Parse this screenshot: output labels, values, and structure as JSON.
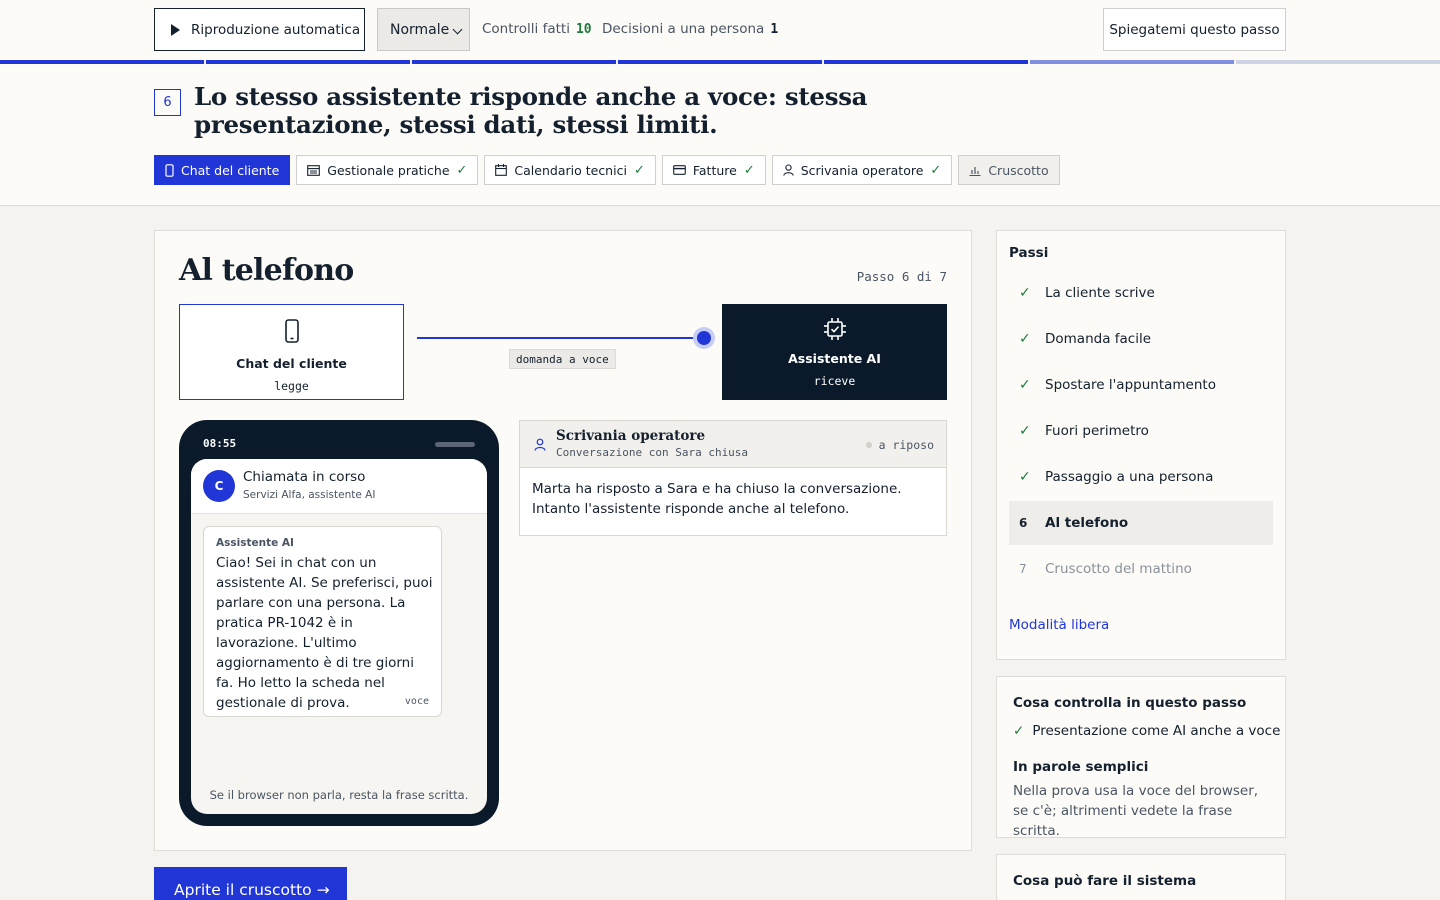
{
  "toolbar": {
    "autoplay_label": "Riproduzione automatica",
    "speed_value": "Normale",
    "checks_label": "Controlli fatti",
    "checks_count": "10",
    "decisions_label": "Decisioni a una persona",
    "decisions_count": "1",
    "explain_label": "Spiegatemi questo passo"
  },
  "progress": {
    "total_steps": 7,
    "current_step": 6,
    "colors": {
      "done": "#2136d6",
      "current": "#7f90e0",
      "todo": "#cfd3e6"
    }
  },
  "header": {
    "step_number": "6",
    "title": "Lo stesso assistente risponde anche a voce: stessa presentazione, stessi dati, stessi limiti."
  },
  "tabs": [
    {
      "label": "Chat del cliente",
      "icon": "phone-icon",
      "state": "active",
      "checked": false
    },
    {
      "label": "Gestionale pratiche",
      "icon": "table-icon",
      "state": "normal",
      "checked": true
    },
    {
      "label": "Calendario tecnici",
      "icon": "calendar-icon",
      "state": "normal",
      "checked": true
    },
    {
      "label": "Fatture",
      "icon": "card-icon",
      "state": "normal",
      "checked": true
    },
    {
      "label": "Scrivania operatore",
      "icon": "user-icon",
      "state": "normal",
      "checked": true
    },
    {
      "label": "Cruscotto",
      "icon": "chart-icon",
      "state": "disabled",
      "checked": false
    }
  ],
  "main": {
    "heading": "Al telefono",
    "step_counter": "Passo 6 di 7",
    "flow": {
      "source_title": "Chat del cliente",
      "source_sub": "legge",
      "link_label": "domanda a voce",
      "target_title": "Assistente AI",
      "target_sub": "riceve"
    },
    "phone": {
      "time": "08:55",
      "avatar_letter": "C",
      "call_title": "Chiamata in corso",
      "call_sub": "Servizi Alfa, assistente AI",
      "bubble_sender": "Assistente AI",
      "bubble_text": "Ciao! Sei in chat con un assistente AI. Se preferisci, puoi parlare con una persona. La pratica PR-1042 è in lavorazione. L'ultimo aggiornamento è di tre giorni fa. Ho letto la scheda nel gestionale di prova.",
      "bubble_tag": "voce",
      "footer_note": "Se il browser non parla, resta la frase scritta."
    },
    "operator": {
      "title": "Scrivania operatore",
      "subtitle": "Conversazione con Sara chiusa",
      "status": "a riposo",
      "body": "Marta ha risposto a Sara e ha chiuso la conversazione. Intanto l'assistente risponde anche al telefono."
    },
    "cta_label": "Aprite il cruscotto →"
  },
  "sidebar": {
    "heading": "Passi",
    "steps": [
      {
        "marker": "✓",
        "label": "La cliente scrive",
        "state": "done"
      },
      {
        "marker": "✓",
        "label": "Domanda facile",
        "state": "done"
      },
      {
        "marker": "✓",
        "label": "Spostare l'appuntamento",
        "state": "done"
      },
      {
        "marker": "✓",
        "label": "Fuori perimetro",
        "state": "done"
      },
      {
        "marker": "✓",
        "label": "Passaggio a una persona",
        "state": "done"
      },
      {
        "marker": "6",
        "label": "Al telefono",
        "state": "current"
      },
      {
        "marker": "7",
        "label": "Cruscotto del mattino",
        "state": "future"
      }
    ],
    "free_mode_link": "Modalità libera"
  },
  "controls": {
    "heading": "Cosa controlla in questo passo",
    "item": "Presentazione come AI anche a voce",
    "plain_heading": "In parole semplici",
    "plain_text": "Nella prova usa la voce del browser, se c'è; altrimenti vedete la frase scritta."
  },
  "capabilities": {
    "heading": "Cosa può fare il sistema"
  }
}
